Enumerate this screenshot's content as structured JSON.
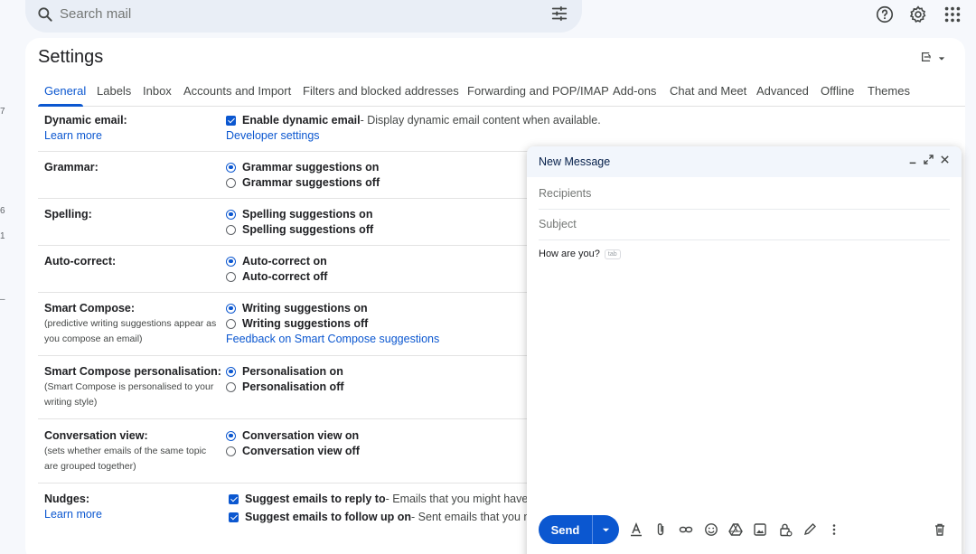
{
  "edge_marks": [
    "7",
    "6",
    "1",
    "–"
  ],
  "search": {
    "placeholder": "Search mail"
  },
  "settings": {
    "title": "Settings",
    "tabs": [
      "General",
      "Labels",
      "Inbox",
      "Accounts and Import",
      "Filters and blocked addresses",
      "Forwarding and POP/IMAP",
      "Add-ons",
      "Chat and Meet",
      "Advanced",
      "Offline",
      "Themes"
    ],
    "active_tab": "General",
    "rows": {
      "dynamic_email": {
        "label": "Dynamic email:",
        "link": "Learn more",
        "option_bold": "Enable dynamic email",
        "option_desc": " - Display dynamic email content when available.",
        "option_link": "Developer settings"
      },
      "grammar": {
        "label": "Grammar:",
        "on": "Grammar suggestions on",
        "off": "Grammar suggestions off"
      },
      "spelling": {
        "label": "Spelling:",
        "on": "Spelling suggestions on",
        "off": "Spelling suggestions off"
      },
      "autocorrect": {
        "label": "Auto-correct:",
        "on": "Auto-correct on",
        "off": "Auto-correct off"
      },
      "smart_compose": {
        "label": "Smart Compose:",
        "sub": "(predictive writing suggestions appear as you compose an email)",
        "on": "Writing suggestions on",
        "off": "Writing suggestions off",
        "feedback": "Feedback on Smart Compose suggestions"
      },
      "personalisation": {
        "label": "Smart Compose personalisation:",
        "sub": "(Smart Compose is personalised to your writing style)",
        "on": "Personalisation on",
        "off": "Personalisation off"
      },
      "conversation": {
        "label": "Conversation view:",
        "sub": "(sets whether emails of the same topic are grouped together)",
        "on": "Conversation view on",
        "off": "Conversation view off"
      },
      "nudges": {
        "label": "Nudges:",
        "link": "Learn more",
        "opt1_bold": "Suggest emails to reply to",
        "opt1_desc": " - Emails that you might have f",
        "opt2_bold": "Suggest emails to follow up on",
        "opt2_desc": " - Sent emails that you mi"
      }
    }
  },
  "compose": {
    "title": "New Message",
    "recipients_placeholder": "Recipients",
    "subject_placeholder": "Subject",
    "body": "How are you?",
    "tab_hint": "tab",
    "send_label": "Send"
  },
  "colors": {
    "accent": "#0b57d0",
    "surface": "#f6f8fc",
    "search_bg": "#e9eef6"
  }
}
